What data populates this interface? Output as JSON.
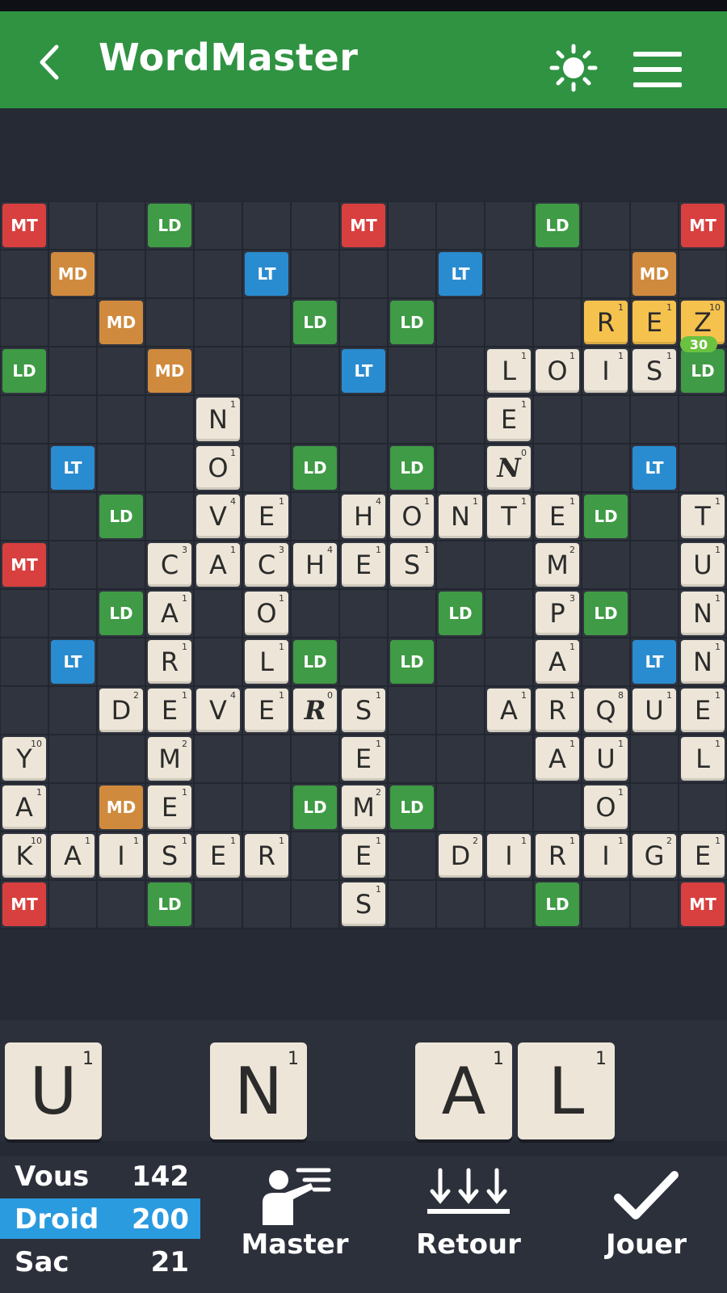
{
  "header": {
    "title": "WordMaster"
  },
  "board": {
    "bonuses": [
      {
        "r": 0,
        "c": 0,
        "t": "MT"
      },
      {
        "r": 0,
        "c": 3,
        "t": "LD"
      },
      {
        "r": 0,
        "c": 7,
        "t": "MT"
      },
      {
        "r": 0,
        "c": 11,
        "t": "LD"
      },
      {
        "r": 0,
        "c": 14,
        "t": "MT"
      },
      {
        "r": 1,
        "c": 1,
        "t": "MD"
      },
      {
        "r": 1,
        "c": 5,
        "t": "LT"
      },
      {
        "r": 1,
        "c": 9,
        "t": "LT"
      },
      {
        "r": 1,
        "c": 13,
        "t": "MD"
      },
      {
        "r": 2,
        "c": 2,
        "t": "MD"
      },
      {
        "r": 2,
        "c": 6,
        "t": "LD"
      },
      {
        "r": 2,
        "c": 8,
        "t": "LD"
      },
      {
        "r": 3,
        "c": 0,
        "t": "LD"
      },
      {
        "r": 3,
        "c": 3,
        "t": "MD"
      },
      {
        "r": 3,
        "c": 7,
        "t": "LT"
      },
      {
        "r": 3,
        "c": 14,
        "t": "LD"
      },
      {
        "r": 5,
        "c": 1,
        "t": "LT"
      },
      {
        "r": 5,
        "c": 6,
        "t": "LD"
      },
      {
        "r": 5,
        "c": 8,
        "t": "LD"
      },
      {
        "r": 5,
        "c": 13,
        "t": "LT"
      },
      {
        "r": 6,
        "c": 2,
        "t": "LD"
      },
      {
        "r": 6,
        "c": 12,
        "t": "LD"
      },
      {
        "r": 7,
        "c": 0,
        "t": "MT"
      },
      {
        "r": 8,
        "c": 2,
        "t": "LD"
      },
      {
        "r": 8,
        "c": 9,
        "t": "LD"
      },
      {
        "r": 8,
        "c": 12,
        "t": "LD"
      },
      {
        "r": 9,
        "c": 1,
        "t": "LT"
      },
      {
        "r": 9,
        "c": 6,
        "t": "LD"
      },
      {
        "r": 9,
        "c": 8,
        "t": "LD"
      },
      {
        "r": 9,
        "c": 13,
        "t": "LT"
      },
      {
        "r": 12,
        "c": 2,
        "t": "MD"
      },
      {
        "r": 12,
        "c": 6,
        "t": "LD"
      },
      {
        "r": 12,
        "c": 8,
        "t": "LD"
      },
      {
        "r": 14,
        "c": 0,
        "t": "MT"
      },
      {
        "r": 14,
        "c": 3,
        "t": "LD"
      },
      {
        "r": 14,
        "c": 11,
        "t": "LD"
      },
      {
        "r": 14,
        "c": 14,
        "t": "MT"
      }
    ],
    "tiles": [
      {
        "r": 2,
        "c": 12,
        "l": "R",
        "p": "1",
        "recent": true
      },
      {
        "r": 2,
        "c": 13,
        "l": "E",
        "p": "1",
        "recent": true
      },
      {
        "r": 2,
        "c": 14,
        "l": "Z",
        "p": "10",
        "recent": true
      },
      {
        "r": 3,
        "c": 10,
        "l": "L",
        "p": "1"
      },
      {
        "r": 3,
        "c": 11,
        "l": "O",
        "p": "1"
      },
      {
        "r": 3,
        "c": 12,
        "l": "I",
        "p": "1"
      },
      {
        "r": 3,
        "c": 13,
        "l": "S",
        "p": "1"
      },
      {
        "r": 4,
        "c": 4,
        "l": "N",
        "p": "1"
      },
      {
        "r": 4,
        "c": 10,
        "l": "E",
        "p": "1"
      },
      {
        "r": 5,
        "c": 4,
        "l": "O",
        "p": "1"
      },
      {
        "r": 5,
        "c": 10,
        "l": "N",
        "p": "0",
        "blank": true
      },
      {
        "r": 6,
        "c": 4,
        "l": "V",
        "p": "4"
      },
      {
        "r": 6,
        "c": 5,
        "l": "E",
        "p": "1"
      },
      {
        "r": 6,
        "c": 7,
        "l": "H",
        "p": "4"
      },
      {
        "r": 6,
        "c": 8,
        "l": "O",
        "p": "1"
      },
      {
        "r": 6,
        "c": 9,
        "l": "N",
        "p": "1"
      },
      {
        "r": 6,
        "c": 10,
        "l": "T",
        "p": "1"
      },
      {
        "r": 6,
        "c": 11,
        "l": "E",
        "p": "1"
      },
      {
        "r": 6,
        "c": 14,
        "l": "T",
        "p": "1"
      },
      {
        "r": 7,
        "c": 3,
        "l": "C",
        "p": "3"
      },
      {
        "r": 7,
        "c": 4,
        "l": "A",
        "p": "1"
      },
      {
        "r": 7,
        "c": 5,
        "l": "C",
        "p": "3"
      },
      {
        "r": 7,
        "c": 6,
        "l": "H",
        "p": "4"
      },
      {
        "r": 7,
        "c": 7,
        "l": "E",
        "p": "1"
      },
      {
        "r": 7,
        "c": 8,
        "l": "S",
        "p": "1"
      },
      {
        "r": 7,
        "c": 11,
        "l": "M",
        "p": "2"
      },
      {
        "r": 7,
        "c": 14,
        "l": "U",
        "p": "1"
      },
      {
        "r": 8,
        "c": 3,
        "l": "A",
        "p": "1"
      },
      {
        "r": 8,
        "c": 5,
        "l": "O",
        "p": "1"
      },
      {
        "r": 8,
        "c": 11,
        "l": "P",
        "p": "3"
      },
      {
        "r": 8,
        "c": 14,
        "l": "N",
        "p": "1"
      },
      {
        "r": 9,
        "c": 3,
        "l": "R",
        "p": "1"
      },
      {
        "r": 9,
        "c": 5,
        "l": "L",
        "p": "1"
      },
      {
        "r": 9,
        "c": 11,
        "l": "A",
        "p": "1"
      },
      {
        "r": 9,
        "c": 14,
        "l": "N",
        "p": "1"
      },
      {
        "r": 10,
        "c": 2,
        "l": "D",
        "p": "2"
      },
      {
        "r": 10,
        "c": 3,
        "l": "E",
        "p": "1"
      },
      {
        "r": 10,
        "c": 4,
        "l": "V",
        "p": "4"
      },
      {
        "r": 10,
        "c": 5,
        "l": "E",
        "p": "1"
      },
      {
        "r": 10,
        "c": 6,
        "l": "R",
        "p": "0",
        "blank": true
      },
      {
        "r": 10,
        "c": 7,
        "l": "S",
        "p": "1"
      },
      {
        "r": 10,
        "c": 10,
        "l": "A",
        "p": "1"
      },
      {
        "r": 10,
        "c": 11,
        "l": "R",
        "p": "1"
      },
      {
        "r": 10,
        "c": 12,
        "l": "Q",
        "p": "8"
      },
      {
        "r": 10,
        "c": 13,
        "l": "U",
        "p": "1"
      },
      {
        "r": 10,
        "c": 14,
        "l": "E",
        "p": "1"
      },
      {
        "r": 11,
        "c": 0,
        "l": "Y",
        "p": "10"
      },
      {
        "r": 11,
        "c": 3,
        "l": "M",
        "p": "2"
      },
      {
        "r": 11,
        "c": 7,
        "l": "E",
        "p": "1"
      },
      {
        "r": 11,
        "c": 11,
        "l": "A",
        "p": "1"
      },
      {
        "r": 11,
        "c": 12,
        "l": "U",
        "p": "1"
      },
      {
        "r": 11,
        "c": 14,
        "l": "L",
        "p": "1"
      },
      {
        "r": 12,
        "c": 0,
        "l": "A",
        "p": "1"
      },
      {
        "r": 12,
        "c": 3,
        "l": "E",
        "p": "1"
      },
      {
        "r": 12,
        "c": 7,
        "l": "M",
        "p": "2"
      },
      {
        "r": 12,
        "c": 12,
        "l": "O",
        "p": "1"
      },
      {
        "r": 13,
        "c": 0,
        "l": "K",
        "p": "10"
      },
      {
        "r": 13,
        "c": 1,
        "l": "A",
        "p": "1"
      },
      {
        "r": 13,
        "c": 2,
        "l": "I",
        "p": "1"
      },
      {
        "r": 13,
        "c": 3,
        "l": "S",
        "p": "1"
      },
      {
        "r": 13,
        "c": 4,
        "l": "E",
        "p": "1"
      },
      {
        "r": 13,
        "c": 5,
        "l": "R",
        "p": "1"
      },
      {
        "r": 13,
        "c": 7,
        "l": "E",
        "p": "1"
      },
      {
        "r": 13,
        "c": 9,
        "l": "D",
        "p": "2"
      },
      {
        "r": 13,
        "c": 10,
        "l": "I",
        "p": "1"
      },
      {
        "r": 13,
        "c": 11,
        "l": "R",
        "p": "1"
      },
      {
        "r": 13,
        "c": 12,
        "l": "I",
        "p": "1"
      },
      {
        "r": 13,
        "c": 13,
        "l": "G",
        "p": "2"
      },
      {
        "r": 13,
        "c": 14,
        "l": "E",
        "p": "1"
      },
      {
        "r": 14,
        "c": 7,
        "l": "S",
        "p": "1"
      }
    ],
    "move_score": "30"
  },
  "rack": [
    {
      "l": "U",
      "p": "1",
      "slot": 0
    },
    {
      "l": "N",
      "p": "1",
      "slot": 2
    },
    {
      "l": "A",
      "p": "1",
      "slot": 4
    },
    {
      "l": "L",
      "p": "1",
      "slot": 5
    }
  ],
  "scores": [
    {
      "name": "Vous",
      "value": "142",
      "active": false
    },
    {
      "name": "Droid",
      "value": "200",
      "active": true
    },
    {
      "name": "Sac",
      "value": "21",
      "active": false
    }
  ],
  "actions": {
    "master_label": "Master",
    "retour_label": "Retour",
    "jouer_label": "Jouer"
  },
  "colors": {
    "appbar": "#2f9342",
    "mt": "#d8403f",
    "md": "#d08a3d",
    "ld": "#3f9b45",
    "lt": "#2a8cd0",
    "tile": "#ede6d8",
    "recent_tile": "#f6c24e",
    "active_score": "#2b9be0"
  }
}
